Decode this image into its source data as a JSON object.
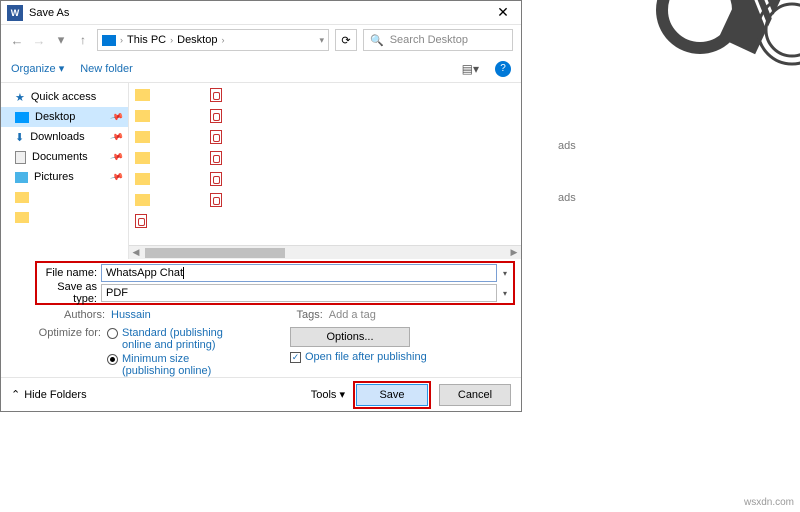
{
  "dialog": {
    "title": "Save As",
    "close_glyph": "✕"
  },
  "nav": {
    "back": "←",
    "fwd": "→",
    "down": "▾",
    "up": "↑",
    "crumb1": "This PC",
    "crumb2": "Desktop",
    "sep": "›",
    "refresh": "⟳",
    "search_placeholder": "Search Desktop",
    "search_icon": "🔍"
  },
  "toolbar": {
    "organize": "Organize ▾",
    "newfolder": "New folder",
    "view": "▤▾",
    "help": "?"
  },
  "sidebar": {
    "quick": "Quick access",
    "desktop": "Desktop",
    "downloads": "Downloads",
    "documents": "Documents",
    "pictures": "Pictures"
  },
  "scroll": {
    "left": "◀",
    "right": "▶"
  },
  "fields": {
    "filename_lbl": "File name:",
    "filename_val": "WhatsApp Chat ",
    "type_lbl": "Save as type:",
    "type_val": "PDF",
    "dd": "▾"
  },
  "meta": {
    "authors_lbl": "Authors:",
    "authors_val": "Hussain",
    "tags_lbl": "Tags:",
    "tags_val": "Add a tag"
  },
  "opt": {
    "label": "Optimize for:",
    "r1": "Standard (publishing online and printing)",
    "r2": "Minimum size (publishing online)",
    "options_btn": "Options...",
    "chk_label": "Open file after publishing",
    "chk_mark": "✓"
  },
  "footer": {
    "hide_caret": "⌃",
    "hide": "Hide Folders",
    "tools": "Tools    ▾",
    "save": "Save",
    "cancel": "Cancel"
  },
  "side": {
    "a": "ads",
    "b": "ads"
  },
  "watermark": "wsxdn.com"
}
